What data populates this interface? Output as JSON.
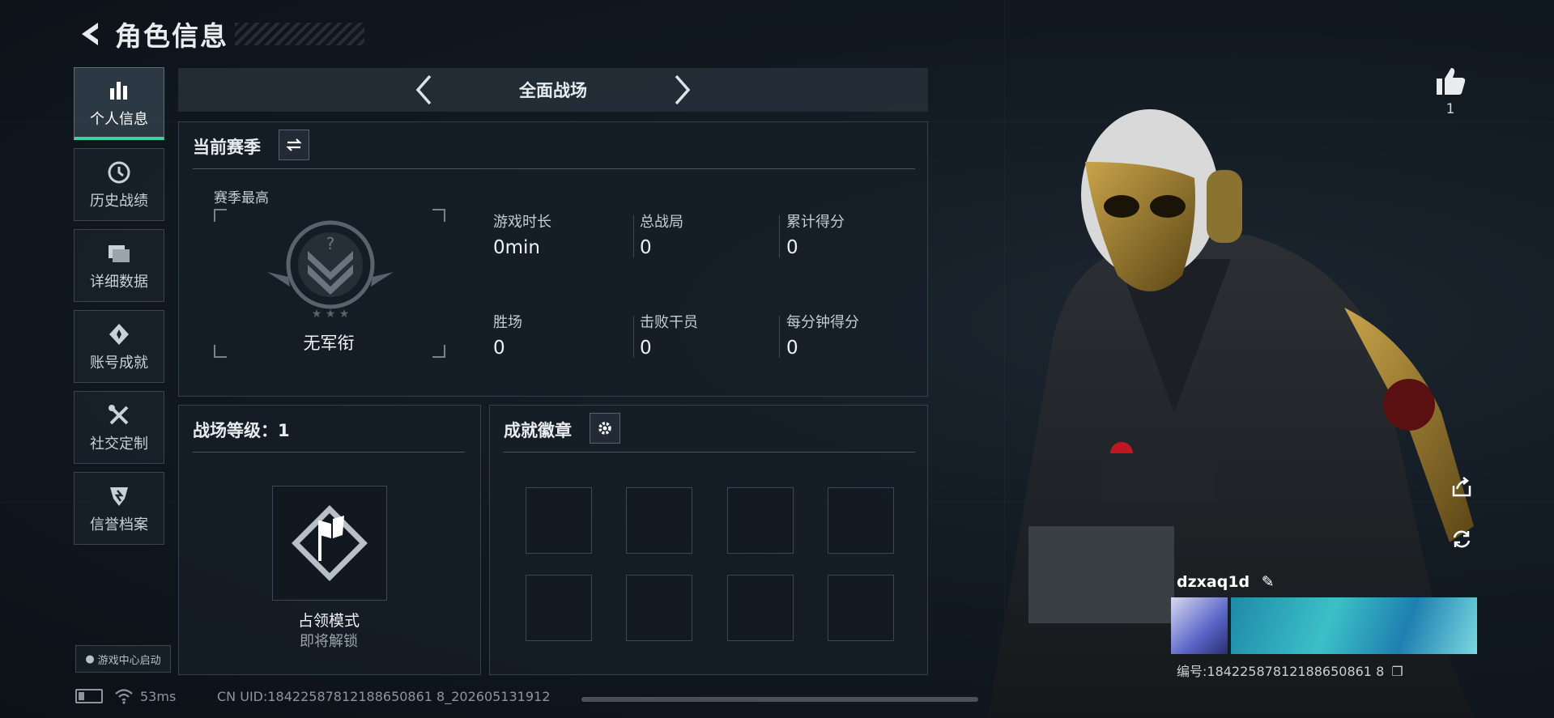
{
  "header": {
    "title": "角色信息"
  },
  "sidebar": {
    "items": [
      {
        "label": "个人信息",
        "icon": "bar-chart-icon",
        "active": true
      },
      {
        "label": "历史战绩",
        "icon": "clock-icon"
      },
      {
        "label": "详细数据",
        "icon": "folder-icon"
      },
      {
        "label": "账号成就",
        "icon": "achievement-icon"
      },
      {
        "label": "社交定制",
        "icon": "tools-icon"
      },
      {
        "label": "信誉档案",
        "icon": "shield-icon"
      }
    ],
    "game_center": "游戏中心启动"
  },
  "mode_selector": {
    "label": "全面战场"
  },
  "season": {
    "title": "当前赛季",
    "best_label": "赛季最高",
    "rank": "无军衔",
    "stats": [
      {
        "label": "游戏时长",
        "value": "0min"
      },
      {
        "label": "总战局",
        "value": "0"
      },
      {
        "label": "累计得分",
        "value": "0"
      },
      {
        "label": "胜场",
        "value": "0"
      },
      {
        "label": "击败干员",
        "value": "0"
      },
      {
        "label": "每分钟得分",
        "value": "0"
      }
    ]
  },
  "battlefield": {
    "level_title": "战场等级：1",
    "mode_name": "占领模式",
    "mode_status": "即将解锁"
  },
  "achievements": {
    "title": "成就徽章"
  },
  "profile": {
    "likes": "1",
    "name": "dzxaq1d",
    "id_text": "编号:18422587812188650861 8"
  },
  "status": {
    "ping": "53ms",
    "cn_uid": "CN UID:18422587812188650861 8_202605131912"
  },
  "colors": {
    "accent": "#3fd2a0",
    "background": "#0f161d"
  }
}
